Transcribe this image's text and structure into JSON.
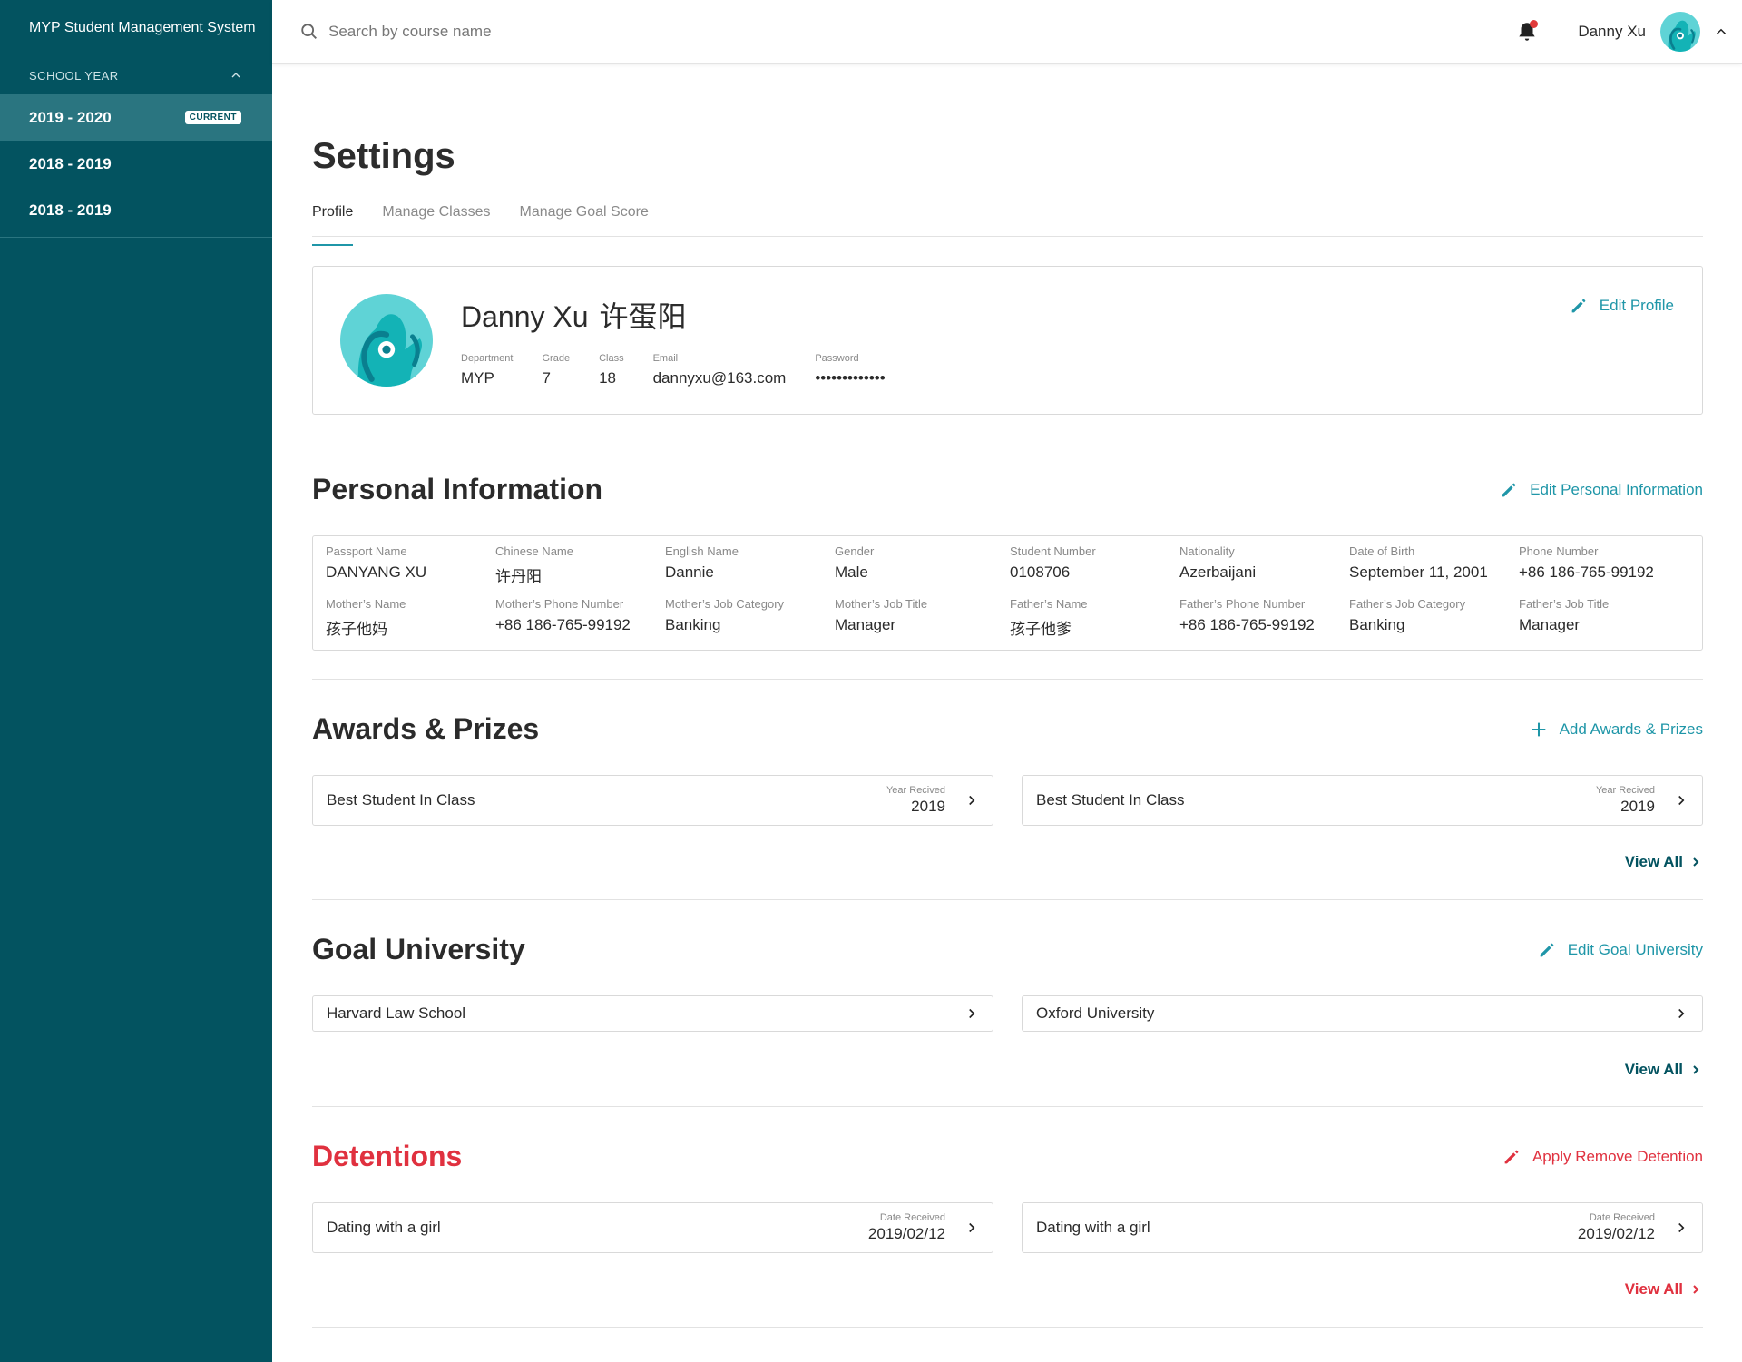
{
  "app": {
    "title": "MYP Student Management System"
  },
  "sidebar": {
    "section_label": "SCHOOL YEAR",
    "years": [
      {
        "label": "2019 - 2020",
        "badge": "CURRENT"
      },
      {
        "label": "2018 - 2019"
      },
      {
        "label": "2018 - 2019"
      }
    ]
  },
  "topbar": {
    "search_placeholder": "Search by course name",
    "user_name": "Danny Xu",
    "notification_dot": true
  },
  "page": {
    "title": "Settings",
    "tabs": [
      "Profile",
      "Manage Classes",
      "Manage Goal Score"
    ],
    "active_tab": "Profile"
  },
  "profile": {
    "name": "Danny Xu",
    "chinese_name": "许蛋阳",
    "edit_label": "Edit Profile",
    "fields": [
      {
        "label": "Department",
        "value": "MYP"
      },
      {
        "label": "Grade",
        "value": "7"
      },
      {
        "label": "Class",
        "value": "18"
      },
      {
        "label": "Email",
        "value": "dannyxu@163.com"
      },
      {
        "label": "Password",
        "value": "•••••••••••••"
      }
    ]
  },
  "personal_info": {
    "title": "Personal Information",
    "edit_label": "Edit Personal Information",
    "fields": [
      {
        "label": "Passport Name",
        "value": "DANYANG XU"
      },
      {
        "label": "Chinese Name",
        "value": "许丹阳"
      },
      {
        "label": "English Name",
        "value": "Dannie"
      },
      {
        "label": "Gender",
        "value": "Male"
      },
      {
        "label": "Student Number",
        "value": "0108706"
      },
      {
        "label": "Nationality",
        "value": "Azerbaijani"
      },
      {
        "label": "Date of Birth",
        "value": "September 11, 2001"
      },
      {
        "label": "Phone Number",
        "value": "+86 186-765-99192"
      },
      {
        "label": "Mother’s Name",
        "value": "孩子他妈"
      },
      {
        "label": "Mother’s Phone Number",
        "value": "+86 186-765-99192"
      },
      {
        "label": "Mother’s Job Category",
        "value": "Banking"
      },
      {
        "label": "Mother’s Job Title",
        "value": "Manager"
      },
      {
        "label": "Father’s Name",
        "value": "孩子他爹"
      },
      {
        "label": "Father’s Phone Number",
        "value": "+86 186-765-99192"
      },
      {
        "label": "Father’s Job Category",
        "value": "Banking"
      },
      {
        "label": "Father’s Job Title",
        "value": "Manager"
      }
    ]
  },
  "awards": {
    "title": "Awards & Prizes",
    "add_label": "Add Awards & Prizes",
    "meta_label": "Year Recived",
    "items": [
      {
        "title": "Best Student In Class",
        "value": "2019"
      },
      {
        "title": "Best Student In Class",
        "value": "2019"
      }
    ],
    "view_all": "View All"
  },
  "goal_university": {
    "title": "Goal University",
    "edit_label": "Edit Goal University",
    "items": [
      {
        "title": "Harvard Law School"
      },
      {
        "title": "Oxford University"
      }
    ],
    "view_all": "View All"
  },
  "detentions": {
    "title": "Detentions",
    "action_label": "Apply Remove Detention",
    "meta_label": "Date Received",
    "items": [
      {
        "title": "Dating with a girl",
        "value": "2019/02/12"
      },
      {
        "title": "Dating with a girl",
        "value": "2019/02/12"
      }
    ],
    "view_all": "View All"
  },
  "colors": {
    "sidebar_bg": "#035360",
    "sidebar_active": "#2a7580",
    "accent": "#1f96a8",
    "danger": "#e0313f",
    "notification": "#e03a3a"
  },
  "icons": [
    "search-icon",
    "bell-icon",
    "chevron-up-icon",
    "chevron-right-icon",
    "pencil-icon",
    "plus-icon"
  ]
}
